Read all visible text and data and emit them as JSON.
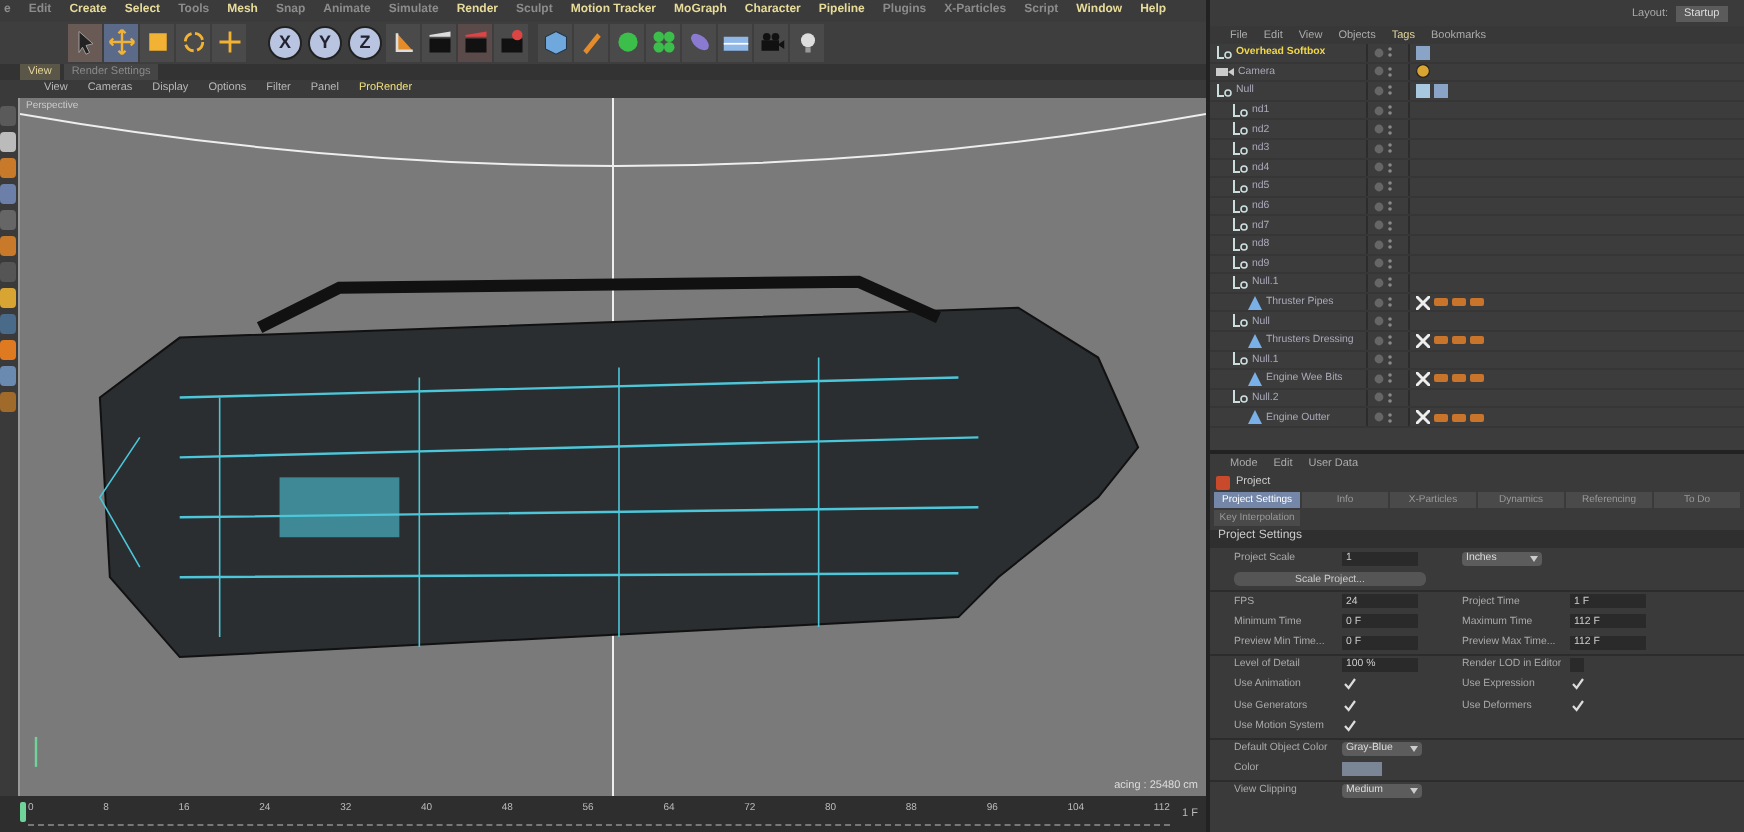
{
  "menubar": [
    {
      "label": "e",
      "dimmed": true
    },
    {
      "label": "Edit",
      "dimmed": true
    },
    {
      "label": "Create",
      "dimmed": false
    },
    {
      "label": "Select",
      "dimmed": false
    },
    {
      "label": "Tools",
      "dimmed": true
    },
    {
      "label": "Mesh",
      "dimmed": false
    },
    {
      "label": "Snap",
      "dimmed": true
    },
    {
      "label": "Animate",
      "dimmed": true
    },
    {
      "label": "Simulate",
      "dimmed": true
    },
    {
      "label": "Render",
      "dimmed": false
    },
    {
      "label": "Sculpt",
      "dimmed": true
    },
    {
      "label": "Motion Tracker",
      "dimmed": false
    },
    {
      "label": "MoGraph",
      "dimmed": false
    },
    {
      "label": "Character",
      "dimmed": false
    },
    {
      "label": "Pipeline",
      "dimmed": false
    },
    {
      "label": "Plugins",
      "dimmed": true
    },
    {
      "label": "X-Particles",
      "dimmed": true
    },
    {
      "label": "Script",
      "dimmed": true
    },
    {
      "label": "Window",
      "dimmed": false
    },
    {
      "label": "Help",
      "dimmed": false
    }
  ],
  "toolbar": {
    "axis_buttons": [
      "X",
      "Y",
      "Z"
    ]
  },
  "layout": {
    "label": "Layout:",
    "value": "Startup"
  },
  "viewport": {
    "tabs": [
      {
        "label": "View",
        "selected": true
      },
      {
        "label": "Render Settings",
        "selected": false
      }
    ],
    "menu": [
      {
        "label": "View",
        "highlighted": false
      },
      {
        "label": "Cameras",
        "highlighted": false
      },
      {
        "label": "Display",
        "highlighted": false
      },
      {
        "label": "Options",
        "highlighted": false
      },
      {
        "label": "Filter",
        "highlighted": false
      },
      {
        "label": "Panel",
        "highlighted": false
      },
      {
        "label": "ProRender",
        "highlighted": true
      }
    ],
    "camera_label": "Perspective",
    "grid_info": "acing : 25480 cm"
  },
  "timeline": {
    "ticks": [
      "0",
      "8",
      "16",
      "24",
      "32",
      "40",
      "48",
      "56",
      "64",
      "72",
      "80",
      "88",
      "96",
      "104",
      "112"
    ],
    "current_frame": "1 F"
  },
  "object_manager": {
    "menu": [
      {
        "label": "File",
        "selected": false
      },
      {
        "label": "Edit",
        "selected": false
      },
      {
        "label": "View",
        "selected": false
      },
      {
        "label": "Objects",
        "selected": false
      },
      {
        "label": "Tags",
        "selected": true
      },
      {
        "label": "Bookmarks",
        "selected": false
      }
    ],
    "objects": [
      {
        "name": "Overhead Softbox",
        "kind": "null",
        "selected": true,
        "tags": [
          {
            "kind": "display"
          }
        ]
      },
      {
        "name": "Camera",
        "kind": "camera",
        "selected": false,
        "tags": [
          {
            "kind": "target"
          }
        ]
      },
      {
        "name": "Null",
        "kind": "null",
        "selected": false,
        "tags": [
          {
            "kind": "texture"
          },
          {
            "kind": "display"
          }
        ],
        "children": [
          {
            "name": "nd1",
            "kind": "null",
            "selected": false
          },
          {
            "name": "nd2",
            "kind": "null",
            "selected": false
          },
          {
            "name": "nd3",
            "kind": "null",
            "selected": false
          },
          {
            "name": "nd4",
            "kind": "null",
            "selected": false
          },
          {
            "name": "nd5",
            "kind": "null",
            "selected": false
          },
          {
            "name": "nd6",
            "kind": "null",
            "selected": false
          },
          {
            "name": "nd7",
            "kind": "null",
            "selected": false
          },
          {
            "name": "nd8",
            "kind": "null",
            "selected": false
          },
          {
            "name": "nd9",
            "kind": "null",
            "selected": false
          },
          {
            "name": "Null.1",
            "kind": "null",
            "selected": false,
            "children": [
              {
                "name": "Thruster Pipes",
                "kind": "mesh",
                "selected": false,
                "tags": [
                  {
                    "kind": "phong"
                  },
                  {
                    "kind": "material"
                  },
                  {
                    "kind": "material"
                  },
                  {
                    "kind": "material"
                  }
                ]
              }
            ]
          },
          {
            "name": "Null",
            "kind": "null",
            "selected": false,
            "children": [
              {
                "name": "Thrusters Dressing",
                "kind": "mesh",
                "selected": false,
                "tags": [
                  {
                    "kind": "phong"
                  },
                  {
                    "kind": "material"
                  },
                  {
                    "kind": "material"
                  },
                  {
                    "kind": "material"
                  }
                ]
              }
            ]
          },
          {
            "name": "Null.1",
            "kind": "null",
            "selected": false,
            "children": [
              {
                "name": "Engine Wee Bits",
                "kind": "mesh",
                "selected": false,
                "tags": [
                  {
                    "kind": "phong"
                  },
                  {
                    "kind": "material"
                  },
                  {
                    "kind": "material"
                  },
                  {
                    "kind": "material"
                  }
                ]
              }
            ]
          },
          {
            "name": "Null.2",
            "kind": "null",
            "selected": false,
            "children": [
              {
                "name": "Engine Outter",
                "kind": "mesh",
                "selected": false,
                "tags": [
                  {
                    "kind": "phong"
                  },
                  {
                    "kind": "material"
                  },
                  {
                    "kind": "material"
                  },
                  {
                    "kind": "material"
                  }
                ]
              }
            ]
          }
        ]
      }
    ]
  },
  "attributes": {
    "menu": [
      "Mode",
      "Edit",
      "User Data"
    ],
    "title": "Project",
    "tabs": [
      {
        "label": "Project Settings",
        "selected": true
      },
      {
        "label": "Info",
        "selected": false
      },
      {
        "label": "X-Particles",
        "selected": false
      },
      {
        "label": "Dynamics",
        "selected": false
      },
      {
        "label": "Referencing",
        "selected": false
      },
      {
        "label": "To Do",
        "selected": false
      },
      {
        "label": "Key Interpolation",
        "selected": false
      }
    ],
    "section": "Project Settings",
    "rows": [
      {
        "items": [
          {
            "kind": "number",
            "label": "Project Scale",
            "value": "1"
          },
          {
            "kind": "dropdown",
            "value": "Inches"
          }
        ]
      },
      {
        "items": [
          {
            "kind": "button",
            "value": "Scale Project..."
          }
        ]
      },
      {
        "items": [
          {
            "kind": "number",
            "label": "FPS",
            "value": "24"
          },
          {
            "kind": "number",
            "label": "Project Time",
            "value": "1 F"
          }
        ]
      },
      {
        "items": [
          {
            "kind": "number",
            "label": "Minimum Time",
            "value": "0 F"
          },
          {
            "kind": "number",
            "label": "Maximum Time",
            "value": "112 F"
          }
        ]
      },
      {
        "items": [
          {
            "kind": "number",
            "label": "Preview Min Time...",
            "value": "0 F"
          },
          {
            "kind": "number",
            "label": "Preview Max Time...",
            "value": "112 F"
          }
        ]
      },
      {
        "items": [
          {
            "kind": "number",
            "label": "Level of Detail",
            "value": "100 %"
          },
          {
            "kind": "checkbox",
            "label": "Render LOD in Editor",
            "checked": false
          }
        ]
      },
      {
        "items": [
          {
            "kind": "checkbox",
            "label": "Use Animation",
            "checked": true
          },
          {
            "kind": "checkbox",
            "label": "Use Expression",
            "checked": true
          }
        ]
      },
      {
        "items": [
          {
            "kind": "checkbox",
            "label": "Use Generators",
            "checked": true
          },
          {
            "kind": "checkbox",
            "label": "Use Deformers",
            "checked": true
          }
        ]
      },
      {
        "items": [
          {
            "kind": "checkbox",
            "label": "Use Motion System",
            "checked": true
          }
        ]
      },
      {
        "items": [
          {
            "kind": "dropdown",
            "label": "Default Object Color",
            "value": "Gray-Blue"
          }
        ]
      },
      {
        "items": [
          {
            "kind": "color",
            "label": "Color",
            "color": "#7a8696"
          }
        ]
      },
      {
        "items": [
          {
            "kind": "dropdown",
            "label": "View Clipping",
            "value": "Medium"
          }
        ]
      }
    ]
  }
}
